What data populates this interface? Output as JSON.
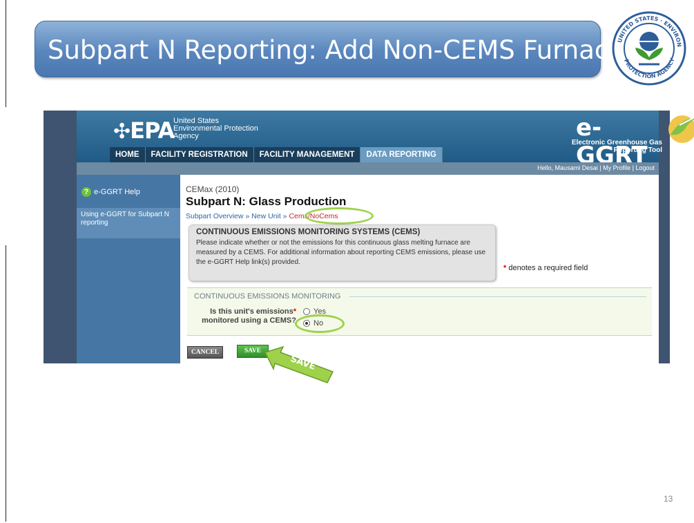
{
  "slide": {
    "title": "Subpart N Reporting: Add Non-CEMS Furnace",
    "page_number": "13",
    "seal_text": "UNITED STATES ENVIRONMENTAL PROTECTION AGENCY"
  },
  "epa": {
    "logo": "EPA",
    "agency_line1": "United States",
    "agency_line2": "Environmental Protection",
    "agency_line3": "Agency"
  },
  "eggrt": {
    "logo": "e-GGRT",
    "sub_line1": "Electronic Greenhouse Gas",
    "sub_line2": "Reporting Tool"
  },
  "nav": {
    "tabs": [
      {
        "label": "HOME"
      },
      {
        "label": "FACILITY REGISTRATION"
      },
      {
        "label": "FACILITY MANAGEMENT"
      },
      {
        "label": "DATA REPORTING"
      }
    ]
  },
  "userbar": {
    "greeting": "Hello, Mausami Desai",
    "separator": "|",
    "profile": "My Profile",
    "logout": "Logout"
  },
  "sidebar": {
    "help_label": "e-GGRT Help",
    "link": "Using e-GGRT for Subpart N reporting"
  },
  "content": {
    "org": "CEMax (2010)",
    "title": "Subpart N: Glass Production",
    "breadcrumb": {
      "item1": "Subpart Overview",
      "sep": " » ",
      "item2": "New Unit",
      "sep2": " » ",
      "current": "Cems/NoCems"
    },
    "info_title": "CONTINUOUS EMISSIONS MONITORING SYSTEMS (CEMS)",
    "info_text": "Please indicate whether or not the emissions for this continuous glass melting furnace are measured by a CEMS. For additional information about reporting CEMS emissions, please use the e-GGRT Help link(s) provided.",
    "required_note": "denotes a required field",
    "required_star": "*",
    "section_header": "CONTINUOUS EMISSIONS MONITORING",
    "question_line1": "Is this unit's emissions",
    "question_line2": "monitored using a CEMS?",
    "options": [
      {
        "label": "Yes",
        "selected": false
      },
      {
        "label": "No",
        "selected": true
      }
    ],
    "cancel_label": "CANCEL",
    "save_label": "SAVE",
    "arrow_label": "SAVE"
  },
  "colors": {
    "title_bar": "#5a86bd",
    "highlight_ring": "#9dd24a",
    "save_button": "#2f8f2b",
    "nav_active": "#6a9bc0"
  }
}
